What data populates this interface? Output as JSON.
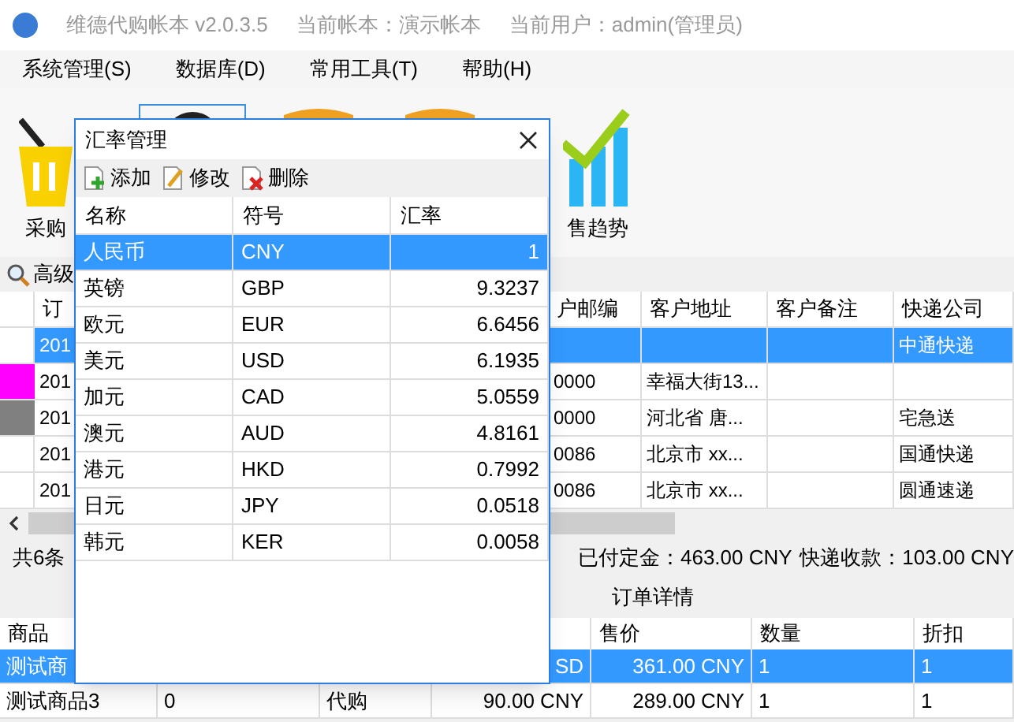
{
  "window": {
    "title": "维德代购帐本  v2.0.3.5",
    "ledger": "当前帐本：演示帐本",
    "user": "当前用户：admin(管理员)"
  },
  "menu": [
    "系统管理(S)",
    "数据库(D)",
    "常用工具(T)",
    "帮助(H)"
  ],
  "toolbar": [
    {
      "kind": "basket",
      "label": "采购",
      "selected": false
    },
    {
      "kind": "magnifier",
      "selected": true
    },
    {
      "kind": "box",
      "selected": false
    },
    {
      "kind": "box",
      "selected": false
    },
    {
      "kind": "trend",
      "label": "售趋势",
      "selected": false
    }
  ],
  "search": {
    "label": "高级"
  },
  "orders": {
    "columns": [
      "订",
      "户邮编",
      "客户地址",
      "客户备注",
      "快递公司"
    ],
    "rows": [
      {
        "selected": true,
        "order": "201",
        "courier": "中通快递"
      },
      {
        "selected": false,
        "color": "#ff00ff",
        "order": "201",
        "postcode": "0000",
        "address": "幸福大街13..."
      },
      {
        "selected": false,
        "color": "#808080",
        "order": "201",
        "postcode": "0000",
        "address": "河北省 唐...",
        "courier": "宅急送"
      },
      {
        "selected": false,
        "order": "201",
        "postcode": "0086",
        "address": "北京市 xx...",
        "courier": "国通快递"
      },
      {
        "selected": false,
        "order": "201",
        "postcode": "0086",
        "address": "北京市 xx...",
        "courier": "圆通速递"
      }
    ]
  },
  "summary": [
    "共6条",
    "已付定金：463.00 CNY",
    "快递收款：103.00 CNY"
  ],
  "details": {
    "title": "订单详情",
    "columns": {
      "product": "商品",
      "price": "售价",
      "qty": "数量",
      "discount": "折扣"
    },
    "rows": [
      {
        "selected": true,
        "product": "测试商",
        "column_4": "SD",
        "price": "361.00 CNY",
        "qty": "1",
        "discount": "1"
      },
      {
        "selected": false,
        "product": "测试商品3",
        "column_2": "0",
        "column_3": "代购",
        "column_4": "90.00 CNY",
        "price": "289.00 CNY",
        "qty": "1",
        "discount": "1"
      }
    ]
  },
  "dialog": {
    "title": "汇率管理",
    "actions": [
      {
        "kind": "add",
        "label": "添加"
      },
      {
        "kind": "edit",
        "label": "修改"
      },
      {
        "kind": "delete",
        "label": "删除"
      }
    ],
    "columns": [
      "名称",
      "符号",
      "汇率"
    ],
    "rows": [
      {
        "selected": true,
        "name": "人民币",
        "code": "CNY",
        "rate": "1"
      },
      {
        "selected": false,
        "name": "英镑",
        "code": "GBP",
        "rate": "9.3237"
      },
      {
        "selected": false,
        "name": "欧元",
        "code": "EUR",
        "rate": "6.6456"
      },
      {
        "selected": false,
        "name": "美元",
        "code": "USD",
        "rate": "6.1935"
      },
      {
        "selected": false,
        "name": "加元",
        "code": "CAD",
        "rate": "5.0559"
      },
      {
        "selected": false,
        "name": "澳元",
        "code": "AUD",
        "rate": "4.8161"
      },
      {
        "selected": false,
        "name": "港元",
        "code": "HKD",
        "rate": "0.7992"
      },
      {
        "selected": false,
        "name": "日元",
        "code": "JPY",
        "rate": "0.0518"
      },
      {
        "selected": false,
        "name": "韩元",
        "code": "KER",
        "rate": "0.0058"
      }
    ]
  }
}
